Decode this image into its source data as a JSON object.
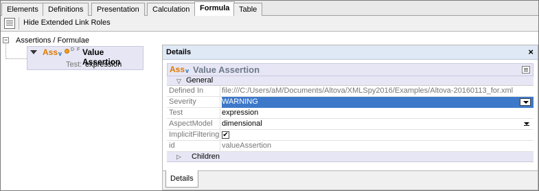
{
  "tabs": [
    "Elements",
    "Definitions",
    "Presentation",
    "Calculation",
    "Formula",
    "Table"
  ],
  "active_tab": "Formula",
  "toolbar": {
    "hide_roles_label": "Hide Extended Link Roles"
  },
  "tree": {
    "toggle": "−",
    "root_label": "Assertions / Formulae",
    "node": {
      "ass": "Ass",
      "ass_sub": "v",
      "flags": "D F",
      "title": "Value Assertion",
      "test_label": "Test:",
      "test_value": "expression"
    }
  },
  "details": {
    "title": "Details",
    "close": "×",
    "header": {
      "ass": "Ass",
      "ass_sub": "v",
      "title": "Value Assertion"
    },
    "section_general": "General",
    "props": [
      {
        "name": "Defined In",
        "value": "file:///C:/Users/aM/Documents/Altova/XMLSpy2016/Examples/Altova-20160113_for.xml"
      },
      {
        "name": "Severity",
        "value": "WARNING"
      },
      {
        "name": "Test",
        "value": "expression"
      },
      {
        "name": "AspectModel",
        "value": "dimensional"
      },
      {
        "name": "ImplicitFiltering",
        "value": "✔"
      },
      {
        "name": "id",
        "value": "valueAssertion"
      }
    ],
    "section_children": "Children",
    "bottom_tab": "Details"
  },
  "colors": {
    "accent": "#3d78c9",
    "ass_orange": "#e07800",
    "panel_header": "#dfe8f5",
    "node_bg": "#e6e6f4"
  }
}
